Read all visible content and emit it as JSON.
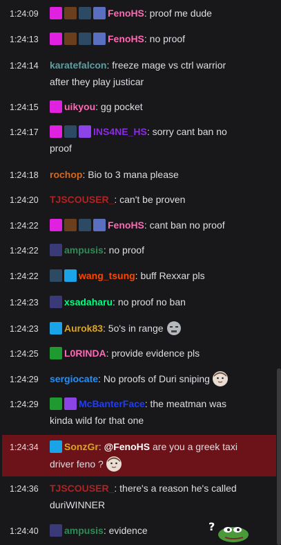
{
  "messages": [
    {
      "time": "1:24:09",
      "user": "FenoHS",
      "color": "#ff69b4",
      "text": ": proof me dude",
      "badges": [
        "gem",
        "hat",
        "blizz",
        "flower"
      ]
    },
    {
      "time": "1:24:13",
      "user": "FenoHS",
      "color": "#ff69b4",
      "text": ": no proof",
      "badges": [
        "gem",
        "hat",
        "blizz",
        "flower"
      ]
    },
    {
      "time": "1:24:14",
      "user": "karatefalcon",
      "color": "#5f9ea0",
      "text": ": freeze mage vs ctrl warrior",
      "text2": "after they play justicar",
      "badges": []
    },
    {
      "time": "1:24:15",
      "user": "uikyou",
      "color": "#ff69b4",
      "text": ": gg pocket",
      "badges": [
        "gem"
      ]
    },
    {
      "time": "1:24:17",
      "user": "INS4NE_HS",
      "color": "#8a2be2",
      "text": ": sorry cant ban no",
      "text2": "proof",
      "badges": [
        "gem",
        "blizz",
        "verified"
      ]
    },
    {
      "time": "1:24:18",
      "user": "rochop",
      "color": "#d2691e",
      "text": ": Bio to 3 mana please",
      "badges": []
    },
    {
      "time": "1:24:20",
      "user": "TJSCOUSER_",
      "color": "#b22222",
      "text": ": can't be proven",
      "badges": []
    },
    {
      "time": "1:24:22",
      "user": "FenoHS",
      "color": "#ff69b4",
      "text": ": cant ban no proof",
      "badges": [
        "gem",
        "hat",
        "blizz",
        "flower"
      ]
    },
    {
      "time": "1:24:22",
      "user": "ampusis",
      "color": "#2e8b57",
      "text": ": no proof",
      "badges": [
        "sub"
      ]
    },
    {
      "time": "1:24:22",
      "user": "wang_tsung",
      "color": "#ff4500",
      "text": ": buff Rexxar pls",
      "badges": [
        "blizz",
        "crown"
      ]
    },
    {
      "time": "1:24:23",
      "user": "xsadaharu",
      "color": "#00ff7f",
      "text": ": no proof no ban",
      "badges": [
        "sub"
      ]
    },
    {
      "time": "1:24:23",
      "user": "Aurok83",
      "color": "#daa520",
      "text": ": 5o's in range",
      "badges": [
        "crown"
      ],
      "emote": "resident-sleeper"
    },
    {
      "time": "1:24:25",
      "user": "L0RINDA",
      "color": "#ff69b4",
      "text": ": provide evidence pls",
      "badges": [
        "mod"
      ]
    },
    {
      "time": "1:24:29",
      "user": "sergiocate",
      "color": "#1e90ff",
      "text": ": No proofs of Duri sniping",
      "badges": [],
      "emote": "face"
    },
    {
      "time": "1:24:29",
      "user": "McBanterFace",
      "color": "#0000ff",
      "text": ": the meatman was",
      "text2": "kinda wild for that one",
      "badges": [
        "mod",
        "verified"
      ]
    },
    {
      "time": "1:24:34",
      "user": "SonzGr",
      "color": "#daa520",
      "text": ": ",
      "mention": "@FenoHS",
      "after": " are you a greek taxi",
      "text2": "driver feno ?",
      "badges": [
        "crown"
      ],
      "emote2": "face",
      "highlight": true
    },
    {
      "time": "1:24:36",
      "user": "TJSCOUSER_",
      "color": "#b22222",
      "text": ": there's a reason he's called",
      "text2": "duriWINNER",
      "badges": []
    },
    {
      "time": "1:24:40",
      "user": "ampusis",
      "color": "#2e8b57",
      "text": ": evidence",
      "badges": [
        "sub"
      ],
      "emote": "pepe-question"
    }
  ],
  "icons": {
    "gem": "gem-icon",
    "hat": "hat-icon",
    "blizz": "blizzard-icon",
    "flower": "flower-icon",
    "verified": "verified-icon",
    "sub": "calendar-icon",
    "crown": "crown-icon",
    "mod": "sword-icon"
  }
}
